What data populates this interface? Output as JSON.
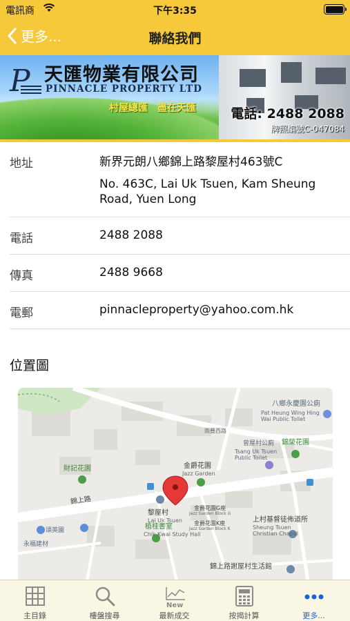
{
  "status_bar": {
    "carrier": "電訊商",
    "time": "下午3:35"
  },
  "nav": {
    "back_label": "更多...",
    "title": "聯絡我們"
  },
  "banner": {
    "company_zh": "天匯物業有限公司",
    "company_en": "PINNACLE PROPERTY LTD",
    "slogan": "村屋總匯　盡在天匯",
    "phone": "電話: 2488 2088",
    "license": "牌照編號C-047084"
  },
  "contact": {
    "address_label": "地址",
    "address_zh": "新界元朗八鄉錦上路黎屋村463號C",
    "address_en": "No. 463C, Lai Uk Tsuen, Kam Sheung Road, Yuen Long",
    "phone_label": "電話",
    "phone": "2488 2088",
    "fax_label": "傳真",
    "fax": "2488 9668",
    "email_label": "電郵",
    "email": "pinnacleproperty@yahoo.com.hk"
  },
  "map_section": {
    "title": "位置圖",
    "labels": {
      "park_zh": "八鄉永慶園公廁",
      "park_en": "Pat Heung Wing Hing Wai Public Toilet",
      "road_zh": "雨豐西路",
      "toilet_zh": "曾屋村公廁",
      "toilet_en": "Tsang Uk Tsuen Public Toilet",
      "garden_zh": "錦榮花園",
      "jazz_zh": "金爵花園",
      "jazz_en": "Jazz Garden",
      "choikee": "財記花園",
      "kam_sheung_road": "錦上路",
      "lai_uk": "黎屋村",
      "lai_uk_en": "Lai Uk Tsuen",
      "jazz_g": "金爵花園G座",
      "jazz_g_en": "Jazz Garden Block G",
      "jazz_k": "金爵花園K座",
      "jazz_k_en": "Jazz Garden Block K",
      "chapel_zh": "上村基督徒佈道所",
      "chapel_en1": "Sheung Tsuen",
      "chapel_en2": "Christian Chapel",
      "study_zh": "植桂書室",
      "study_en": "Chik Kwai Study Hall",
      "ying": "頌英園",
      "wing_fuk": "永福建材",
      "hall": "錦上路謝屋村生活館"
    }
  },
  "tabs": [
    {
      "label": "主目錄",
      "icon": "grid-icon"
    },
    {
      "label": "樓盤搜尋",
      "icon": "search-icon"
    },
    {
      "label": "最新成交",
      "icon": "chart-new-icon"
    },
    {
      "label": "按揭計算",
      "icon": "calculator-icon"
    },
    {
      "label": "更多...",
      "icon": "more-icon",
      "active": true
    }
  ],
  "colors": {
    "header": "#f6c93b",
    "active_tab": "#1565d8",
    "tabbar": "#faf6e4"
  }
}
